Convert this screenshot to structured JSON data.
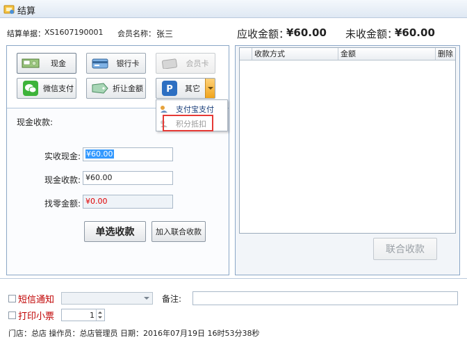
{
  "window": {
    "title": "结算"
  },
  "info": {
    "order_label": "结算单据：",
    "order_no": "XS1607190001",
    "member_label": "会员名称：",
    "member_name": "张三",
    "due_label": "应收金额：",
    "due_value": "¥60.00",
    "unpaid_label": "未收金额：",
    "unpaid_value": "¥60.00"
  },
  "payment_methods": {
    "cash": "现金",
    "bank_card": "银行卡",
    "member_card": "会员卡",
    "wechat": "微信支付",
    "discount": "折让金额",
    "other": "其它"
  },
  "other_menu": {
    "alipay": "支付宝支付",
    "points": "积分抵扣"
  },
  "cash": {
    "section_title": "现金收款:",
    "actual_label": "实收现金:",
    "actual_value": "¥60.00",
    "received_label": "现金收款:",
    "received_value": "¥60.00",
    "change_label": "找零金额:",
    "change_value": "¥0.00",
    "single_btn": "单选收款",
    "add_joint_btn": "加入联合收款"
  },
  "grid": {
    "columns": [
      "收款方式",
      "金额",
      "删除"
    ]
  },
  "joint_btn": "联合收款",
  "bottom": {
    "sms_label": "短信通知",
    "note_label": "备注:",
    "print_label": "打印小票",
    "print_count": "1",
    "footer": "门店：总店    操作员：总店管理员    日期：2016年07月19日 16时53分38秒"
  },
  "colors": {
    "accent_red": "#c00000",
    "selection_blue": "#3399ff",
    "highlight_red": "#e53935"
  }
}
